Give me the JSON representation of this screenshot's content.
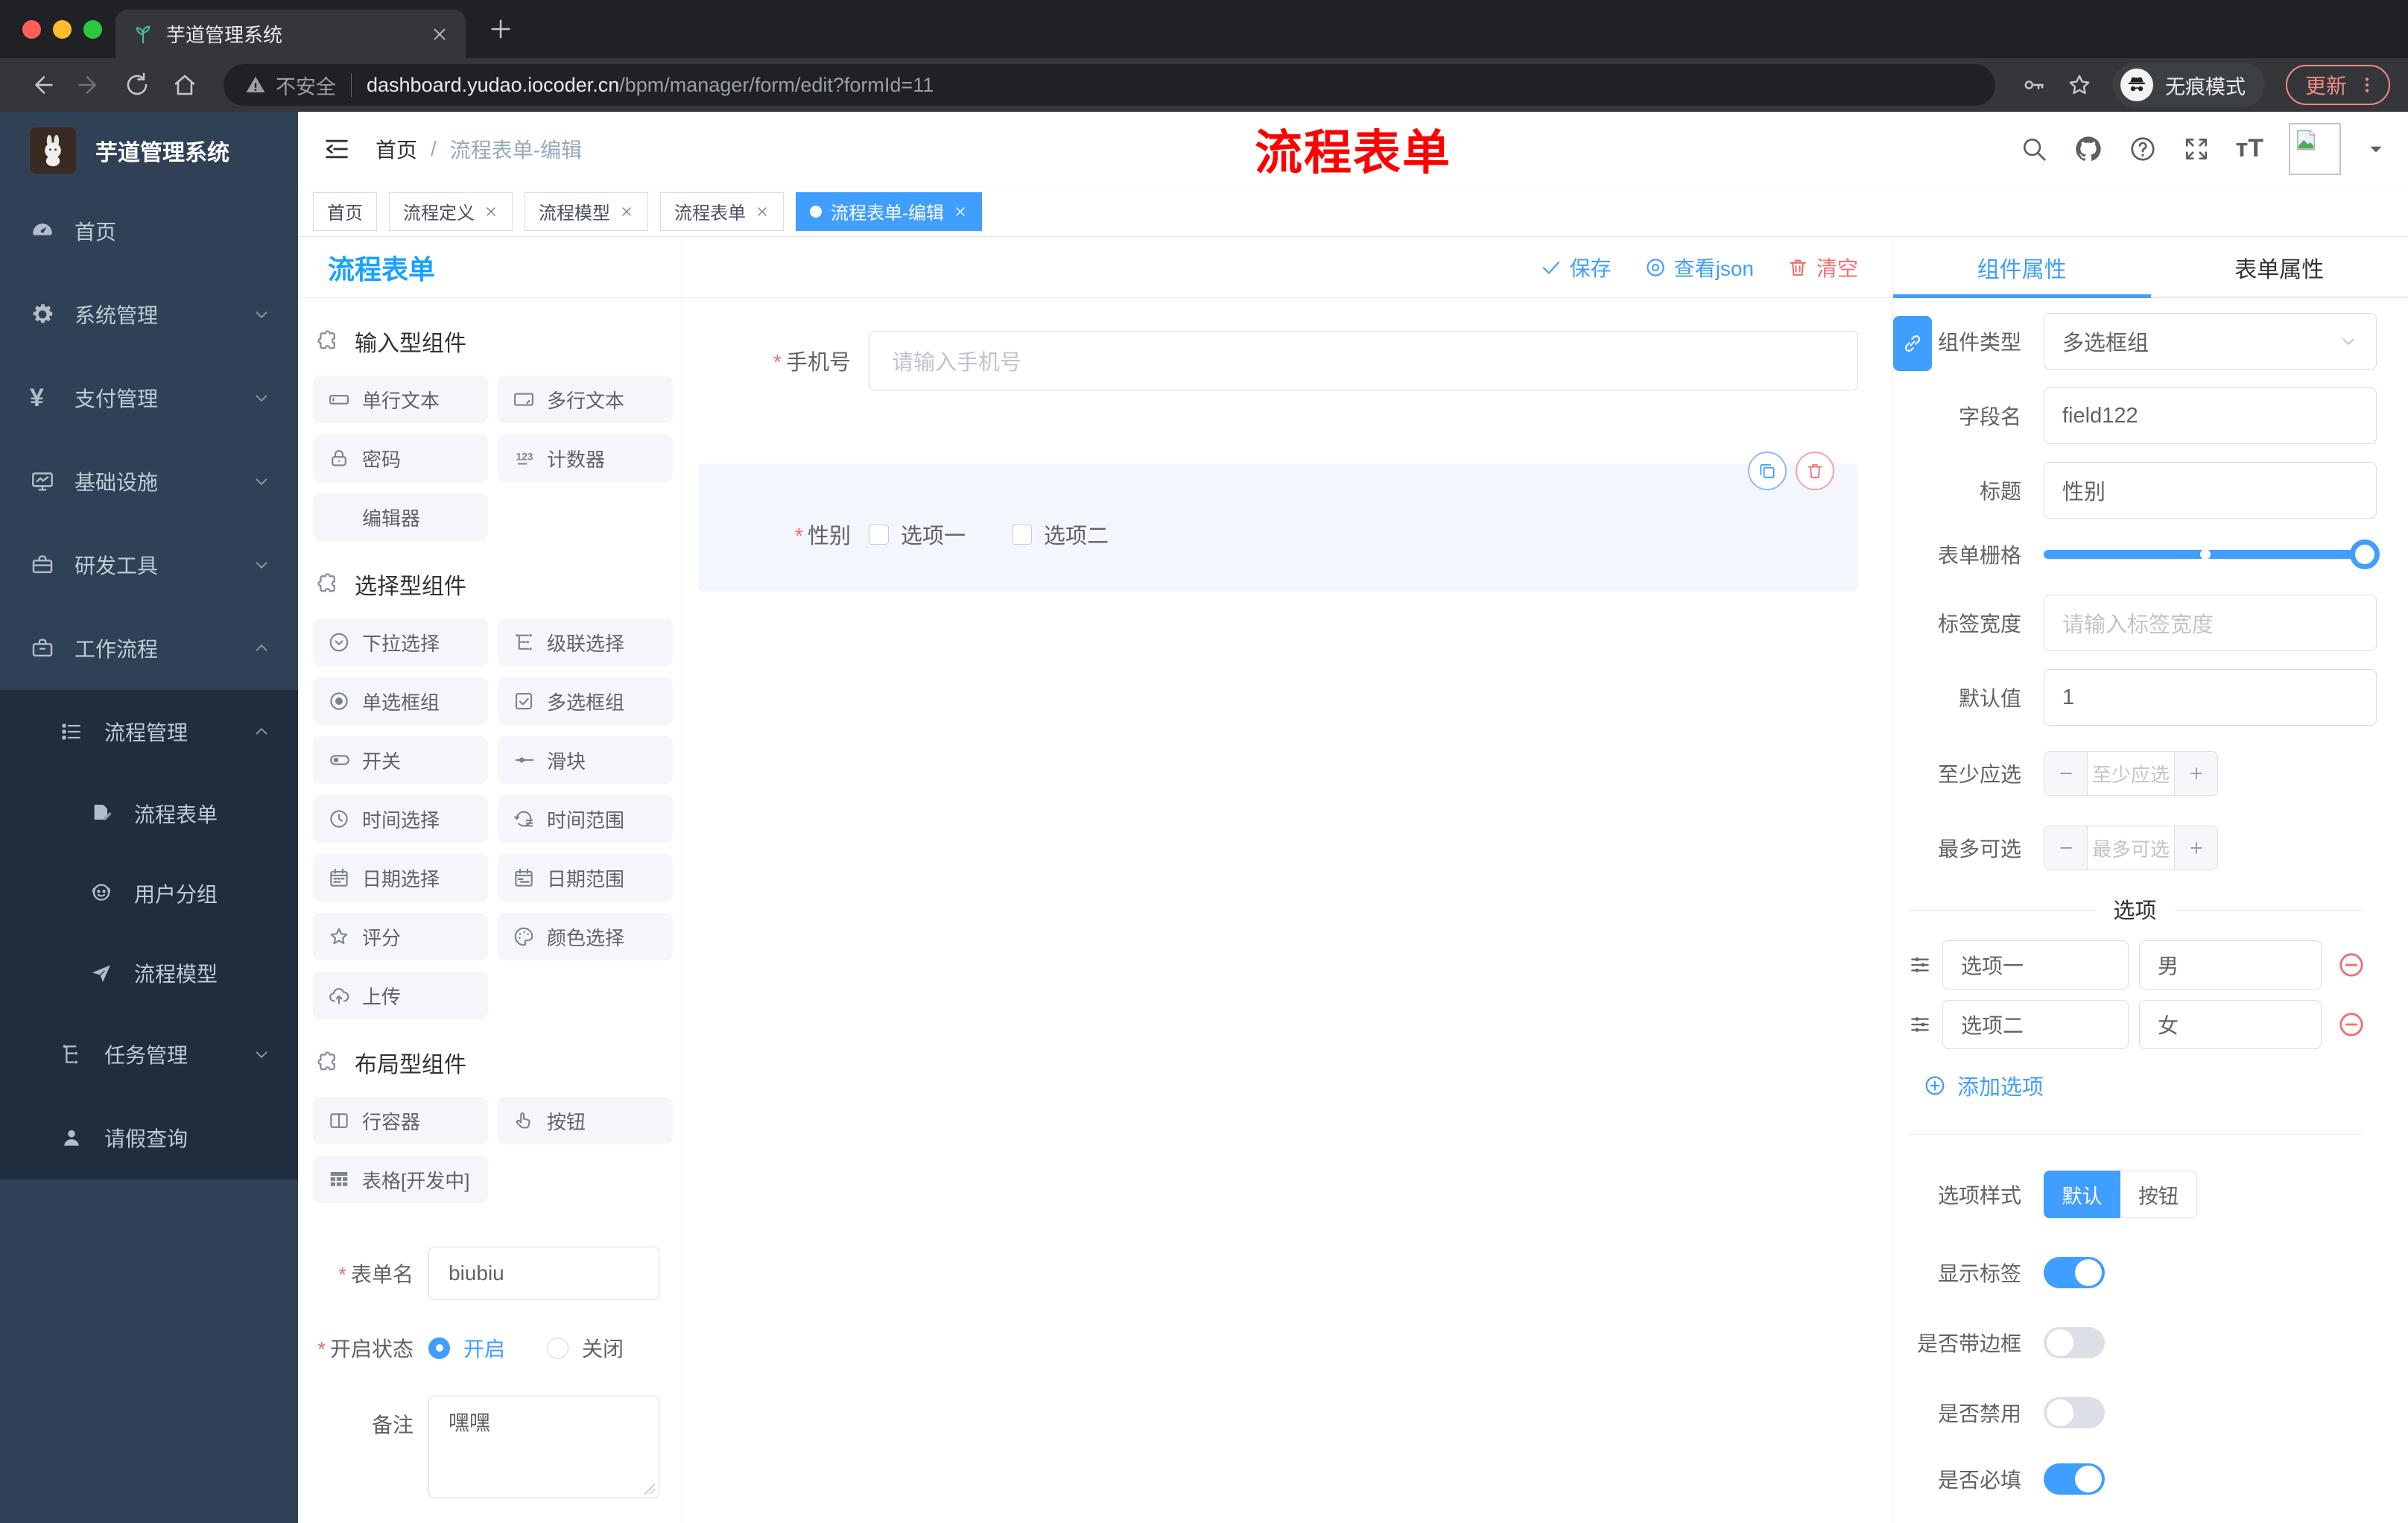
{
  "browser": {
    "tab_title": "芋道管理系统",
    "security_label": "不安全",
    "url_domain": "dashboard.yudao.iocoder.cn",
    "url_path": "/bpm/manager/form/edit?formId=11",
    "incognito_label": "无痕模式",
    "update_label": "更新"
  },
  "sidebar": {
    "logo_title": "芋道管理系统",
    "items": [
      {
        "label": "首页",
        "icon": "dashboard-icon"
      },
      {
        "label": "系统管理",
        "icon": "gear-icon"
      },
      {
        "label": "支付管理",
        "icon": "yen-icon"
      },
      {
        "label": "基础设施",
        "icon": "monitor-icon"
      },
      {
        "label": "研发工具",
        "icon": "toolbox-icon"
      },
      {
        "label": "工作流程",
        "icon": "briefcase-icon"
      }
    ],
    "workflow": {
      "process_mgmt": {
        "label": "流程管理",
        "icon": "list-icon"
      },
      "children": [
        {
          "label": "流程表单",
          "icon": "doc-edit-icon"
        },
        {
          "label": "用户分组",
          "icon": "face-icon"
        },
        {
          "label": "流程模型",
          "icon": "paper-plane-icon"
        }
      ],
      "task_mgmt": {
        "label": "任务管理",
        "icon": "tree-icon"
      },
      "leave_query": {
        "label": "请假查询",
        "icon": "user-icon"
      }
    }
  },
  "header": {
    "breadcrumb_home": "首页",
    "breadcrumb_current": "流程表单-编辑",
    "annotation": "流程表单",
    "annotation_color": "#ff0000"
  },
  "tags": [
    {
      "label": "首页"
    },
    {
      "label": "流程定义"
    },
    {
      "label": "流程模型"
    },
    {
      "label": "流程表单"
    },
    {
      "label": "流程表单-编辑"
    }
  ],
  "designer": {
    "panel_title": "流程表单",
    "toolbar": {
      "save": "保存",
      "view_json": "查看json",
      "clear": "清空"
    },
    "sections": [
      {
        "title": "输入型组件",
        "items": [
          {
            "label": "单行文本",
            "icon": "input-icon"
          },
          {
            "label": "多行文本",
            "icon": "textarea-icon"
          },
          {
            "label": "密码",
            "icon": "lock-icon"
          },
          {
            "label": "计数器",
            "icon": "counter-icon"
          },
          {
            "label": "编辑器",
            "icon": "editor-icon"
          }
        ]
      },
      {
        "title": "选择型组件",
        "items": [
          {
            "label": "下拉选择",
            "icon": "select-icon"
          },
          {
            "label": "级联选择",
            "icon": "cascade-icon"
          },
          {
            "label": "单选框组",
            "icon": "radio-icon"
          },
          {
            "label": "多选框组",
            "icon": "checkbox-icon"
          },
          {
            "label": "开关",
            "icon": "switch-icon"
          },
          {
            "label": "滑块",
            "icon": "slider-icon"
          },
          {
            "label": "时间选择",
            "icon": "time-icon"
          },
          {
            "label": "时间范围",
            "icon": "time-range-icon"
          },
          {
            "label": "日期选择",
            "icon": "date-icon"
          },
          {
            "label": "日期范围",
            "icon": "date-range-icon"
          },
          {
            "label": "评分",
            "icon": "star-icon"
          },
          {
            "label": "颜色选择",
            "icon": "palette-icon"
          },
          {
            "label": "上传",
            "icon": "upload-icon"
          }
        ]
      },
      {
        "title": "布局型组件",
        "items": [
          {
            "label": "行容器",
            "icon": "row-container-icon"
          },
          {
            "label": "按钮",
            "icon": "pointer-icon"
          },
          {
            "label": "表格[开发中]",
            "icon": "table-icon"
          }
        ]
      }
    ],
    "settings": {
      "name_label": "表单名",
      "name_value": "biubiu",
      "status_label": "开启状态",
      "status_on": "开启",
      "status_off": "关闭",
      "remark_label": "备注",
      "remark_value": "嘿嘿"
    }
  },
  "canvas": {
    "phone_label": "手机号",
    "phone_placeholder": "请输入手机号",
    "gender_label": "性别",
    "gender_options": [
      "选项一",
      "选项二"
    ]
  },
  "props": {
    "tab_component": "组件属性",
    "tab_form": "表单属性",
    "type_label": "组件类型",
    "type_value": "多选框组",
    "field_label": "字段名",
    "field_value": "field122",
    "title_label": "标题",
    "title_value": "性别",
    "grid_label": "表单栅格",
    "label_width_label": "标签宽度",
    "label_width_placeholder": "请输入标签宽度",
    "default_label": "默认值",
    "default_value": "1",
    "min_label": "至少应选",
    "min_placeholder": "至少应选",
    "max_label": "最多可选",
    "max_placeholder": "最多可选",
    "options_divider": "选项",
    "options": [
      {
        "label": "选项一",
        "value": "男"
      },
      {
        "label": "选项二",
        "value": "女"
      }
    ],
    "add_option": "添加选项",
    "style_label": "选项样式",
    "style_default": "默认",
    "style_button": "按钮",
    "toggles": [
      {
        "label": "显示标签",
        "on": true
      },
      {
        "label": "是否带边框",
        "on": false
      },
      {
        "label": "是否禁用",
        "on": false
      },
      {
        "label": "是否必填",
        "on": true
      }
    ],
    "accent_color": "#409eff"
  }
}
